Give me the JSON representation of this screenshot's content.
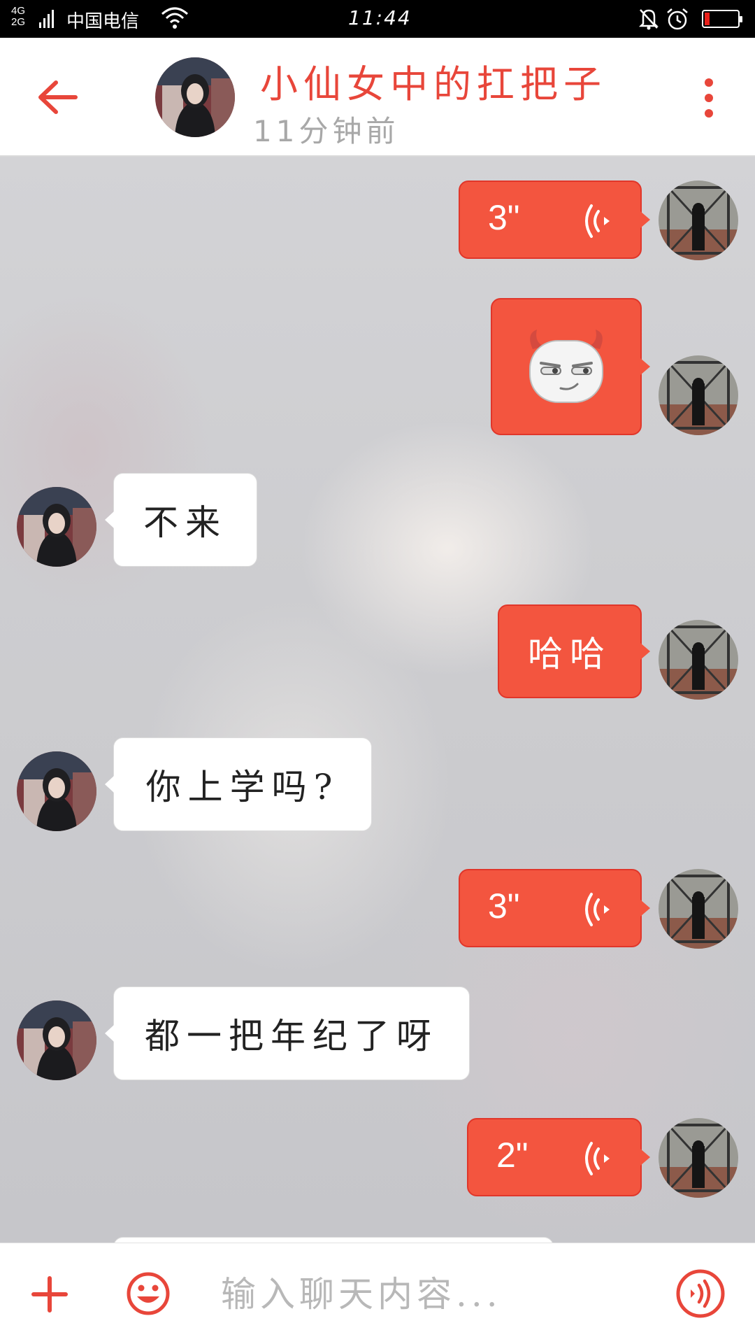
{
  "status_bar": {
    "network_top": "4G",
    "network_bottom": "2G",
    "carrier": "中国电信",
    "time": "11:44",
    "battery_level": 0.15
  },
  "header": {
    "title": "小仙女中的扛把子",
    "subtitle": "11分钟前"
  },
  "messages": [
    {
      "side": "out",
      "type": "voice",
      "duration": "3\""
    },
    {
      "side": "out",
      "type": "sticker",
      "sticker": "devil-face"
    },
    {
      "side": "in",
      "type": "text",
      "text": "不来"
    },
    {
      "side": "out",
      "type": "text",
      "text": "哈哈"
    },
    {
      "side": "in",
      "type": "text",
      "text": "你上学吗?"
    },
    {
      "side": "out",
      "type": "voice",
      "duration": "3\""
    },
    {
      "side": "in",
      "type": "text",
      "text": "都一把年纪了呀"
    },
    {
      "side": "out",
      "type": "voice",
      "duration": "2\""
    }
  ],
  "input": {
    "placeholder": "输入聊天内容..."
  },
  "colors": {
    "accent": "#f3553f",
    "title": "#e8463a",
    "subtitle": "#a8a8a8"
  }
}
